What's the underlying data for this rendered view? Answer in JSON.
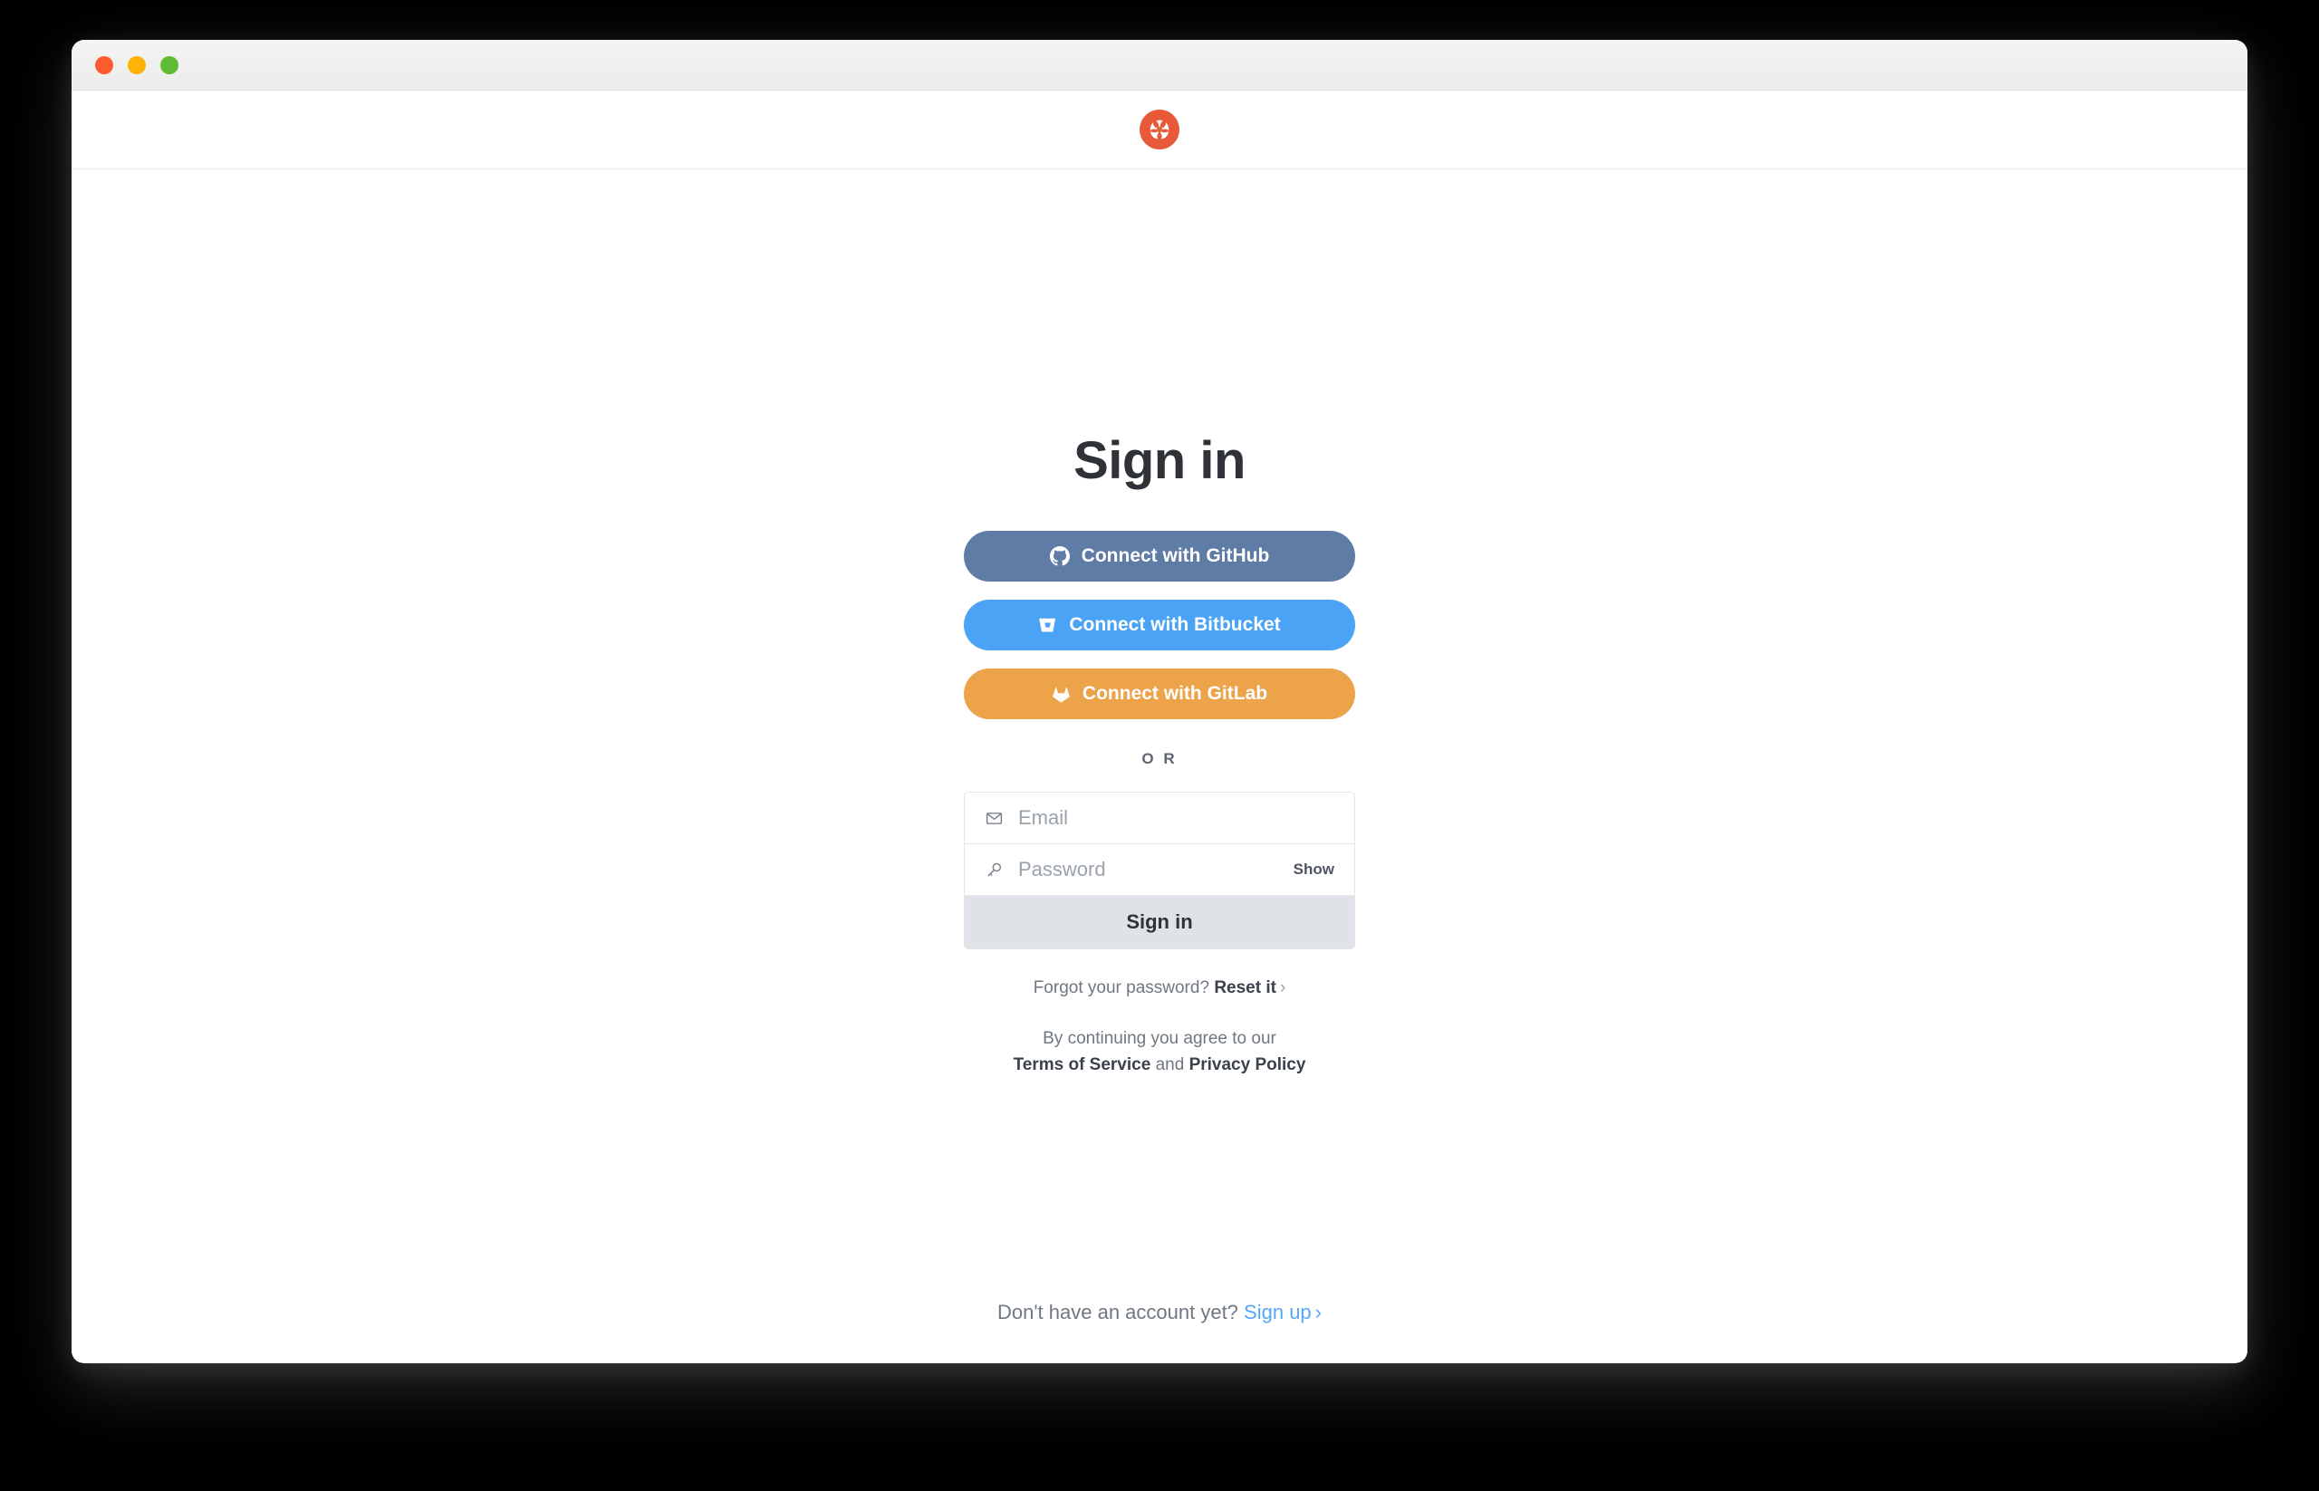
{
  "window": {
    "traffic_lights": [
      {
        "name": "close",
        "color": "#fc5b2f"
      },
      {
        "name": "minimize",
        "color": "#ffb108"
      },
      {
        "name": "maximize",
        "color": "#5ebb35"
      }
    ]
  },
  "header": {
    "logo_name": "app-logo-icon",
    "logo_color": "#e8593a"
  },
  "main": {
    "title": "Sign in",
    "oauth_buttons": [
      {
        "label": "Connect with GitHub",
        "icon": "github-icon",
        "color": "#5e7ca6"
      },
      {
        "label": "Connect with Bitbucket",
        "icon": "bitbucket-icon",
        "color": "#4aa3f5"
      },
      {
        "label": "Connect with GitLab",
        "icon": "gitlab-icon",
        "color": "#eda349"
      }
    ],
    "separator": "O R",
    "form": {
      "email": {
        "placeholder": "Email",
        "value": "",
        "icon": "envelope-icon"
      },
      "password": {
        "placeholder": "Password",
        "value": "",
        "icon": "key-icon",
        "show_label": "Show"
      },
      "submit_label": "Sign in"
    },
    "forgot": {
      "text": "Forgot your password?",
      "link": "Reset it",
      "chevron": "›"
    },
    "legal": {
      "line1": "By continuing you agree to our",
      "terms": "Terms of Service",
      "conjunction": "and",
      "privacy": "Privacy Policy"
    }
  },
  "footer": {
    "text": "Don't have an account yet?",
    "link": "Sign up",
    "chevron": "›",
    "link_color": "#55a7f7"
  }
}
